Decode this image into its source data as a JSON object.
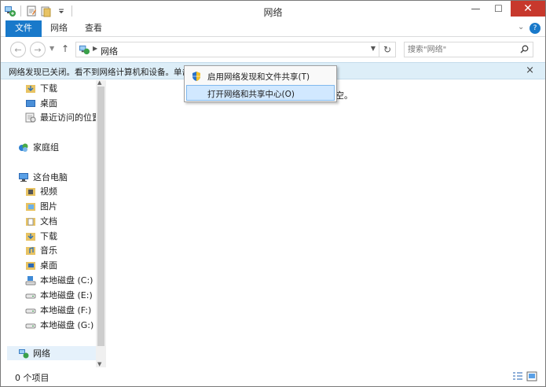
{
  "window": {
    "title": "网络",
    "controls": {
      "minimize": "—",
      "maximize": "☐",
      "close": "✕"
    }
  },
  "ribbon": {
    "tabs": [
      "文件",
      "网络",
      "查看"
    ],
    "expand": "⌄",
    "help": "?"
  },
  "address": {
    "crumb": "网络",
    "search_placeholder": "搜索\"网络\""
  },
  "infobar": {
    "message": "网络发现已关闭。看不到网络计算机和设备。单击"
  },
  "context_menu": {
    "items": [
      "启用网络发现和文件共享(T)",
      "打开网络和共享中心(O)"
    ]
  },
  "content": {
    "empty_tail": "空。"
  },
  "nav": {
    "items": [
      "下载",
      "桌面",
      "最近访问的位置",
      "家庭组",
      "这台电脑",
      "视频",
      "图片",
      "文档",
      "下载",
      "音乐",
      "桌面",
      "本地磁盘 (C:)",
      "本地磁盘 (E:)",
      "本地磁盘 (F:)",
      "本地磁盘 (G:)",
      "网络"
    ]
  },
  "status": {
    "count": "0 个项目"
  },
  "colors": {
    "accent": "#1979ca",
    "infobar": "#ddeef8",
    "close": "#c7382c",
    "menu_highlight": "#d1e8ff"
  }
}
